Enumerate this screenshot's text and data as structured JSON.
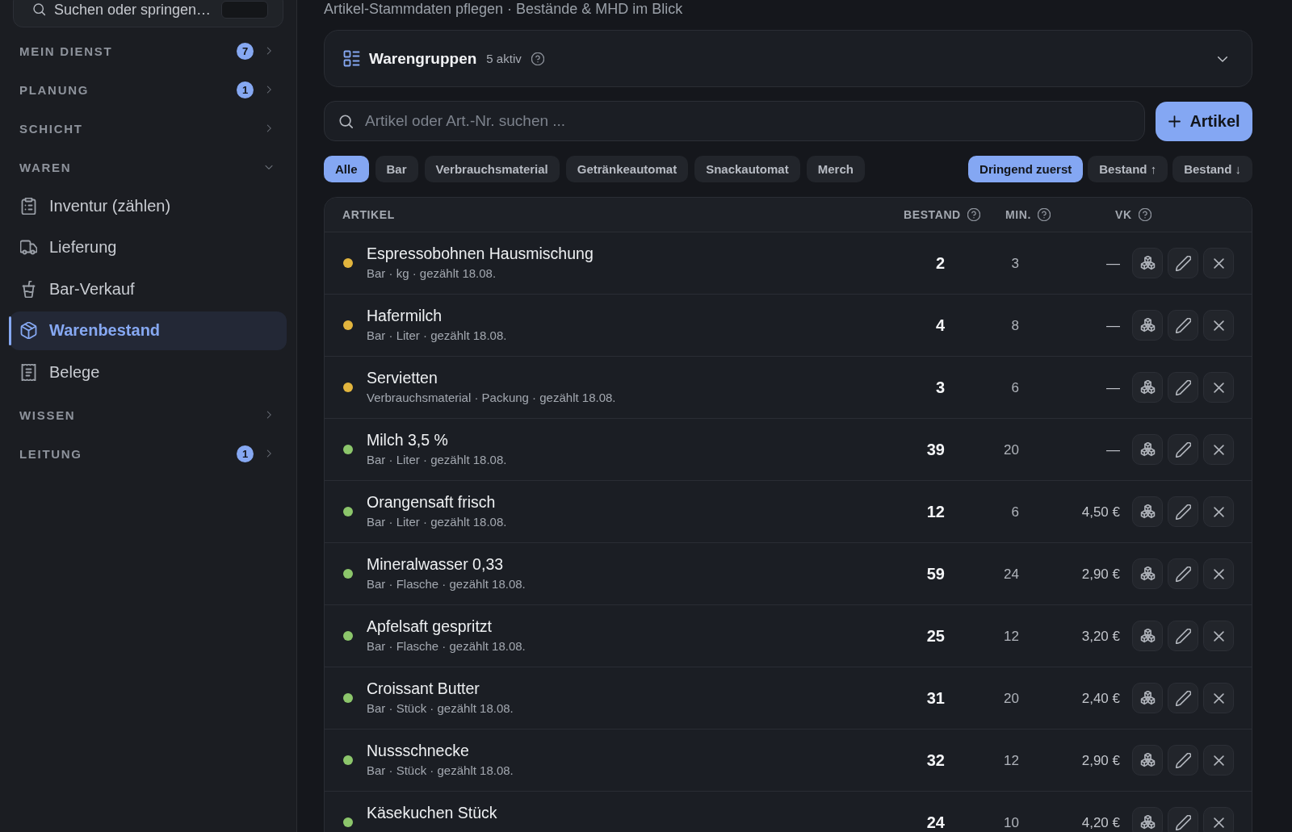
{
  "sidebar": {
    "search": {
      "placeholder": "Suchen oder springen…"
    },
    "sections": [
      {
        "label": "MEIN DIENST",
        "badge": "7",
        "expanded": false
      },
      {
        "label": "PLANUNG",
        "badge": "1",
        "expanded": false
      },
      {
        "label": "SCHICHT",
        "expanded": false
      },
      {
        "label": "WAREN",
        "expanded": true,
        "items": [
          {
            "label": "Inventur (zählen)",
            "selected": false
          },
          {
            "label": "Lieferung",
            "selected": false
          },
          {
            "label": "Bar-Verkauf",
            "selected": false
          },
          {
            "label": "Warenbestand",
            "selected": true
          },
          {
            "label": "Belege",
            "selected": false
          }
        ]
      },
      {
        "label": "WISSEN",
        "expanded": false
      },
      {
        "label": "LEITUNG",
        "badge": "1",
        "expanded": false
      }
    ]
  },
  "page": {
    "subtitle": "Artikel-Stammdaten pflegen · Bestände & MHD im Blick",
    "groups_panel": {
      "title": "Warengruppen",
      "count": "5 aktiv",
      "expanded": false
    },
    "search": {
      "placeholder": "Artikel oder Art.-Nr. suchen ..."
    },
    "add_button": {
      "label": "Artikel"
    },
    "filters": [
      {
        "label": "Alle",
        "selected": true
      },
      {
        "label": "Bar",
        "selected": false
      },
      {
        "label": "Verbrauchsmaterial",
        "selected": false
      },
      {
        "label": "Getränkeautomat",
        "selected": false
      },
      {
        "label": "Snackautomat",
        "selected": false
      },
      {
        "label": "Merch",
        "selected": false
      }
    ],
    "sort_options": [
      {
        "label": "Dringend zuerst",
        "selected": true
      },
      {
        "label": "Bestand ↑",
        "selected": false
      },
      {
        "label": "Bestand ↓",
        "selected": false
      }
    ],
    "table": {
      "columns": [
        {
          "label": "ARTIKEL",
          "help": false
        },
        {
          "label": "BESTAND",
          "help": true
        },
        {
          "label": "MIN.",
          "help": true
        },
        {
          "label": "VK",
          "help": true
        }
      ],
      "rows": [
        {
          "name": "Espressobohnen Hausmischung",
          "meta": "Bar · kg · gezählt 18.08.",
          "color": "#e2b53e",
          "stock": "2",
          "min": "3",
          "price": "—"
        },
        {
          "name": "Hafermilch",
          "meta": "Bar · Liter · gezählt 18.08.",
          "color": "#e2b53e",
          "stock": "4",
          "min": "8",
          "price": "—"
        },
        {
          "name": "Servietten",
          "meta": "Verbrauchsmaterial · Packung · gezählt 18.08.",
          "color": "#e2b53e",
          "stock": "3",
          "min": "6",
          "price": "—"
        },
        {
          "name": "Milch 3,5 %",
          "meta": "Bar · Liter · gezählt 18.08.",
          "color": "#8cc66b",
          "stock": "39",
          "min": "20",
          "price": "—"
        },
        {
          "name": "Orangensaft frisch",
          "meta": "Bar · Liter · gezählt 18.08.",
          "color": "#8cc66b",
          "stock": "12",
          "min": "6",
          "price": "4,50 €"
        },
        {
          "name": "Mineralwasser 0,33",
          "meta": "Bar · Flasche · gezählt 18.08.",
          "color": "#8cc66b",
          "stock": "59",
          "min": "24",
          "price": "2,90 €"
        },
        {
          "name": "Apfelsaft gespritzt",
          "meta": "Bar · Flasche · gezählt 18.08.",
          "color": "#8cc66b",
          "stock": "25",
          "min": "12",
          "price": "3,20 €"
        },
        {
          "name": "Croissant Butter",
          "meta": "Bar · Stück · gezählt 18.08.",
          "color": "#8cc66b",
          "stock": "31",
          "min": "20",
          "price": "2,40 €"
        },
        {
          "name": "Nussschnecke",
          "meta": "Bar · Stück · gezählt 18.08.",
          "color": "#8cc66b",
          "stock": "32",
          "min": "12",
          "price": "2,90 €"
        },
        {
          "name": "Käsekuchen Stück",
          "color": "#8cc66b",
          "stock": "24",
          "min": "10",
          "price": "4,20 €"
        }
      ]
    }
  }
}
